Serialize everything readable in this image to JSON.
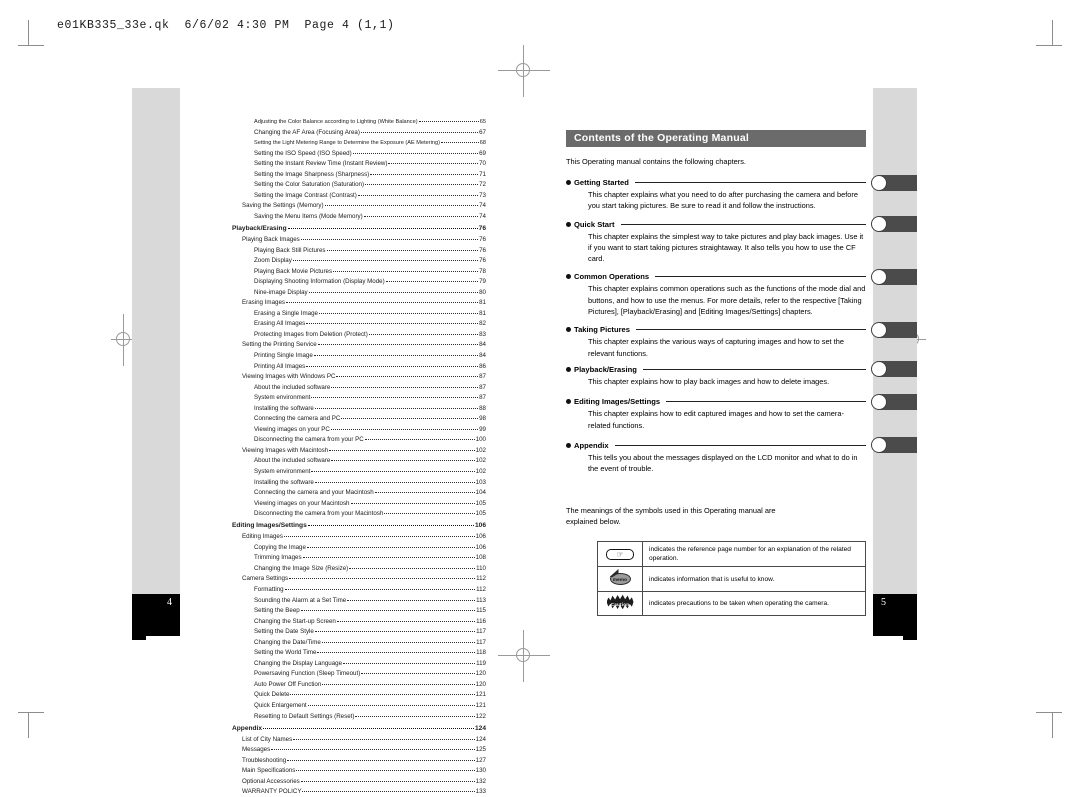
{
  "slug": "e01KB335_33e.qk  6/6/02 4:30 PM  Page 4 (1,1)",
  "left_page": {
    "page_number": "4",
    "toc_rows": [
      {
        "level": 2,
        "title": "Adjusting the Color Balance according to Lighting (White Balance)",
        "page": "65",
        "style": "tight"
      },
      {
        "level": 2,
        "title": "Changing the AF Area (Focusing Area)",
        "page": "67",
        "style": "normal"
      },
      {
        "level": 2,
        "title": "Setting the Light Metering Range to Determine the Exposure (AE Metering)",
        "page": "68",
        "style": "tight"
      },
      {
        "level": 2,
        "title": "Setting the ISO Speed (ISO Speed)",
        "page": "69",
        "style": "normal"
      },
      {
        "level": 2,
        "title": "Setting the Instant Review Time (Instant Review)",
        "page": "70",
        "style": "normal"
      },
      {
        "level": 2,
        "title": "Setting the Image Sharpness (Sharpness)",
        "page": "71",
        "style": "normal"
      },
      {
        "level": 2,
        "title": "Setting the Color Saturation (Saturation)",
        "page": "72",
        "style": "normal"
      },
      {
        "level": 2,
        "title": "Setting the Image Contrast (Contrast)",
        "page": "73",
        "style": "normal"
      },
      {
        "level": 1,
        "title": "Saving the Settings (Memory)",
        "page": "74",
        "style": "normal"
      },
      {
        "level": 2,
        "title": "Saving the Menu Items (Mode Memory)",
        "page": "74",
        "style": "normal"
      },
      {
        "level": 0,
        "title": "Playback/Erasing",
        "page": "76",
        "style": "chapter"
      },
      {
        "level": 1,
        "title": "Playing Back Images",
        "page": "76",
        "style": "normal"
      },
      {
        "level": 2,
        "title": "Playing Back Still Pictures",
        "page": "76",
        "style": "normal"
      },
      {
        "level": 2,
        "title": "Zoom Display",
        "page": "76",
        "style": "normal"
      },
      {
        "level": 2,
        "title": "Playing Back Movie Pictures",
        "page": "78",
        "style": "normal"
      },
      {
        "level": 2,
        "title": "Displaying Shooting Information (Display Mode)",
        "page": "79",
        "style": "normal"
      },
      {
        "level": 2,
        "title": "Nine-image Display",
        "page": "80",
        "style": "normal"
      },
      {
        "level": 1,
        "title": "Erasing Images",
        "page": "81",
        "style": "normal"
      },
      {
        "level": 2,
        "title": "Erasing a Single Image",
        "page": "81",
        "style": "normal"
      },
      {
        "level": 2,
        "title": "Erasing All Images",
        "page": "82",
        "style": "normal"
      },
      {
        "level": 2,
        "title": "Protecting Images from Deletion (Protect)",
        "page": "83",
        "style": "normal"
      },
      {
        "level": 1,
        "title": "Setting the Printing Service",
        "page": "84",
        "style": "normal"
      },
      {
        "level": 2,
        "title": "Printing Single Image",
        "page": "84",
        "style": "normal"
      },
      {
        "level": 2,
        "title": "Printing All Images",
        "page": "86",
        "style": "normal"
      },
      {
        "level": 1,
        "title": "Viewing Images with Windows PC",
        "page": "87",
        "style": "normal"
      },
      {
        "level": 2,
        "title": "About the included software",
        "page": "87",
        "style": "normal"
      },
      {
        "level": 2,
        "title": "System environment",
        "page": "87",
        "style": "normal"
      },
      {
        "level": 2,
        "title": "Installing the software",
        "page": "88",
        "style": "normal"
      },
      {
        "level": 2,
        "title": "Connecting the camera and PC",
        "page": "98",
        "style": "normal"
      },
      {
        "level": 2,
        "title": "Viewing images on your PC",
        "page": "99",
        "style": "normal"
      },
      {
        "level": 2,
        "title": "Disconnecting the camera from your PC",
        "page": "100",
        "style": "normal"
      },
      {
        "level": 1,
        "title": "Viewing Images with Macintosh",
        "page": "102",
        "style": "normal"
      },
      {
        "level": 2,
        "title": "About the included software",
        "page": "102",
        "style": "normal"
      },
      {
        "level": 2,
        "title": "System environment",
        "page": "102",
        "style": "normal"
      },
      {
        "level": 2,
        "title": "Installing the software",
        "page": "103",
        "style": "normal"
      },
      {
        "level": 2,
        "title": "Connecting the camera and your Macintosh",
        "page": "104",
        "style": "normal"
      },
      {
        "level": 2,
        "title": "Viewing images on your Macintosh",
        "page": "105",
        "style": "normal"
      },
      {
        "level": 2,
        "title": "Disconnecting the camera from your Macintosh",
        "page": "105",
        "style": "normal"
      },
      {
        "level": 0,
        "title": "Editing Images/Settings",
        "page": "106",
        "style": "chapter"
      },
      {
        "level": 1,
        "title": "Editing Images",
        "page": "106",
        "style": "normal"
      },
      {
        "level": 2,
        "title": "Copying the Image",
        "page": "106",
        "style": "normal"
      },
      {
        "level": 2,
        "title": "Trimming Images",
        "page": "108",
        "style": "normal"
      },
      {
        "level": 2,
        "title": "Changing the Image Size (Resize)",
        "page": "110",
        "style": "normal"
      },
      {
        "level": 1,
        "title": "Camera Settings",
        "page": "112",
        "style": "normal"
      },
      {
        "level": 2,
        "title": "Formatting",
        "page": "112",
        "style": "normal"
      },
      {
        "level": 2,
        "title": "Sounding the Alarm at a Set Time",
        "page": "113",
        "style": "normal"
      },
      {
        "level": 2,
        "title": "Setting the Beep",
        "page": "115",
        "style": "normal"
      },
      {
        "level": 2,
        "title": "Changing the Start-up Screen",
        "page": "116",
        "style": "normal"
      },
      {
        "level": 2,
        "title": "Setting the Date Style",
        "page": "117",
        "style": "normal"
      },
      {
        "level": 2,
        "title": "Changing the Date/Time",
        "page": "117",
        "style": "normal"
      },
      {
        "level": 2,
        "title": "Setting the World Time",
        "page": "118",
        "style": "normal"
      },
      {
        "level": 2,
        "title": "Changing the Display Language",
        "page": "119",
        "style": "normal"
      },
      {
        "level": 2,
        "title": "Powersaving Function (Sleep Timeout)",
        "page": "120",
        "style": "normal"
      },
      {
        "level": 2,
        "title": "Auto Power Off Function",
        "page": "120",
        "style": "normal"
      },
      {
        "level": 2,
        "title": "Quick Delete",
        "page": "121",
        "style": "normal"
      },
      {
        "level": 2,
        "title": "Quick Enlargement",
        "page": "121",
        "style": "normal"
      },
      {
        "level": 2,
        "title": "Resetting to Default Settings (Reset)",
        "page": "122",
        "style": "normal"
      },
      {
        "level": 0,
        "title": "Appendix",
        "page": "124",
        "style": "chapter"
      },
      {
        "level": 1,
        "title": "List of City Names",
        "page": "124",
        "style": "normal"
      },
      {
        "level": 1,
        "title": "Messages",
        "page": "125",
        "style": "normal"
      },
      {
        "level": 1,
        "title": "Troubleshooting",
        "page": "127",
        "style": "normal"
      },
      {
        "level": 1,
        "title": "Main Specifications",
        "page": "130",
        "style": "normal"
      },
      {
        "level": 1,
        "title": "Optional Accessories",
        "page": "132",
        "style": "normal"
      },
      {
        "level": 1,
        "title": "WARRANTY POLICY",
        "page": "133",
        "style": "normal"
      }
    ]
  },
  "right_page": {
    "page_number": "5",
    "title_bar": "Contents of the Operating Manual",
    "intro": "This Operating manual contains the following chapters.",
    "symbols_intro_line1": "The meanings of the symbols used in this Operating manual are",
    "symbols_intro_line2": "explained below.",
    "chapters": [
      {
        "label": "Getting Started",
        "body": "This chapter explains what you need to do after purchasing the camera and before you start taking pictures. Be sure to read it and follow the instructions."
      },
      {
        "label": "Quick Start",
        "body": "This chapter explains the simplest way to take pictures and play back images. Use it if you want to start taking pictures straightaway. It also tells you how to use the CF card."
      },
      {
        "label": "Common Operations",
        "body": "This chapter explains common operations such as the functions of the mode dial and buttons, and how to use the menus. For more details, refer to the respective [Taking Pictures], [Playback/Erasing] and [Editing Images/Settings] chapters."
      },
      {
        "label": "Taking Pictures",
        "body": "This chapter explains the various ways of capturing images and how to set the relevant functions."
      },
      {
        "label": "Playback/Erasing",
        "body": "This chapter explains how to play back images and how to delete images."
      },
      {
        "label": "Editing Images/Settings",
        "body": "This chapter explains how to edit captured images and how to set the camera-related functions."
      },
      {
        "label": "Appendix",
        "body": "This tells you about the messages displayed on the LCD monitor and what to do in the event of trouble."
      }
    ],
    "symbols": [
      {
        "icon": "reference-page-icon",
        "glyph": "☞",
        "text": "indicates the reference page number for an explanation of the related operation."
      },
      {
        "icon": "memo-icon",
        "glyph": "memo",
        "text": "indicates information that is useful to know."
      },
      {
        "icon": "caution-icon",
        "glyph": "Caution",
        "text": "indicates precautions to be taken when operating the camera."
      }
    ]
  },
  "colors": {
    "title_bar_bg": "#6b6b6b",
    "stripe_gray": "#d9d9d9",
    "tab_gray": "#4b4b4b",
    "page_block": "#000000"
  }
}
